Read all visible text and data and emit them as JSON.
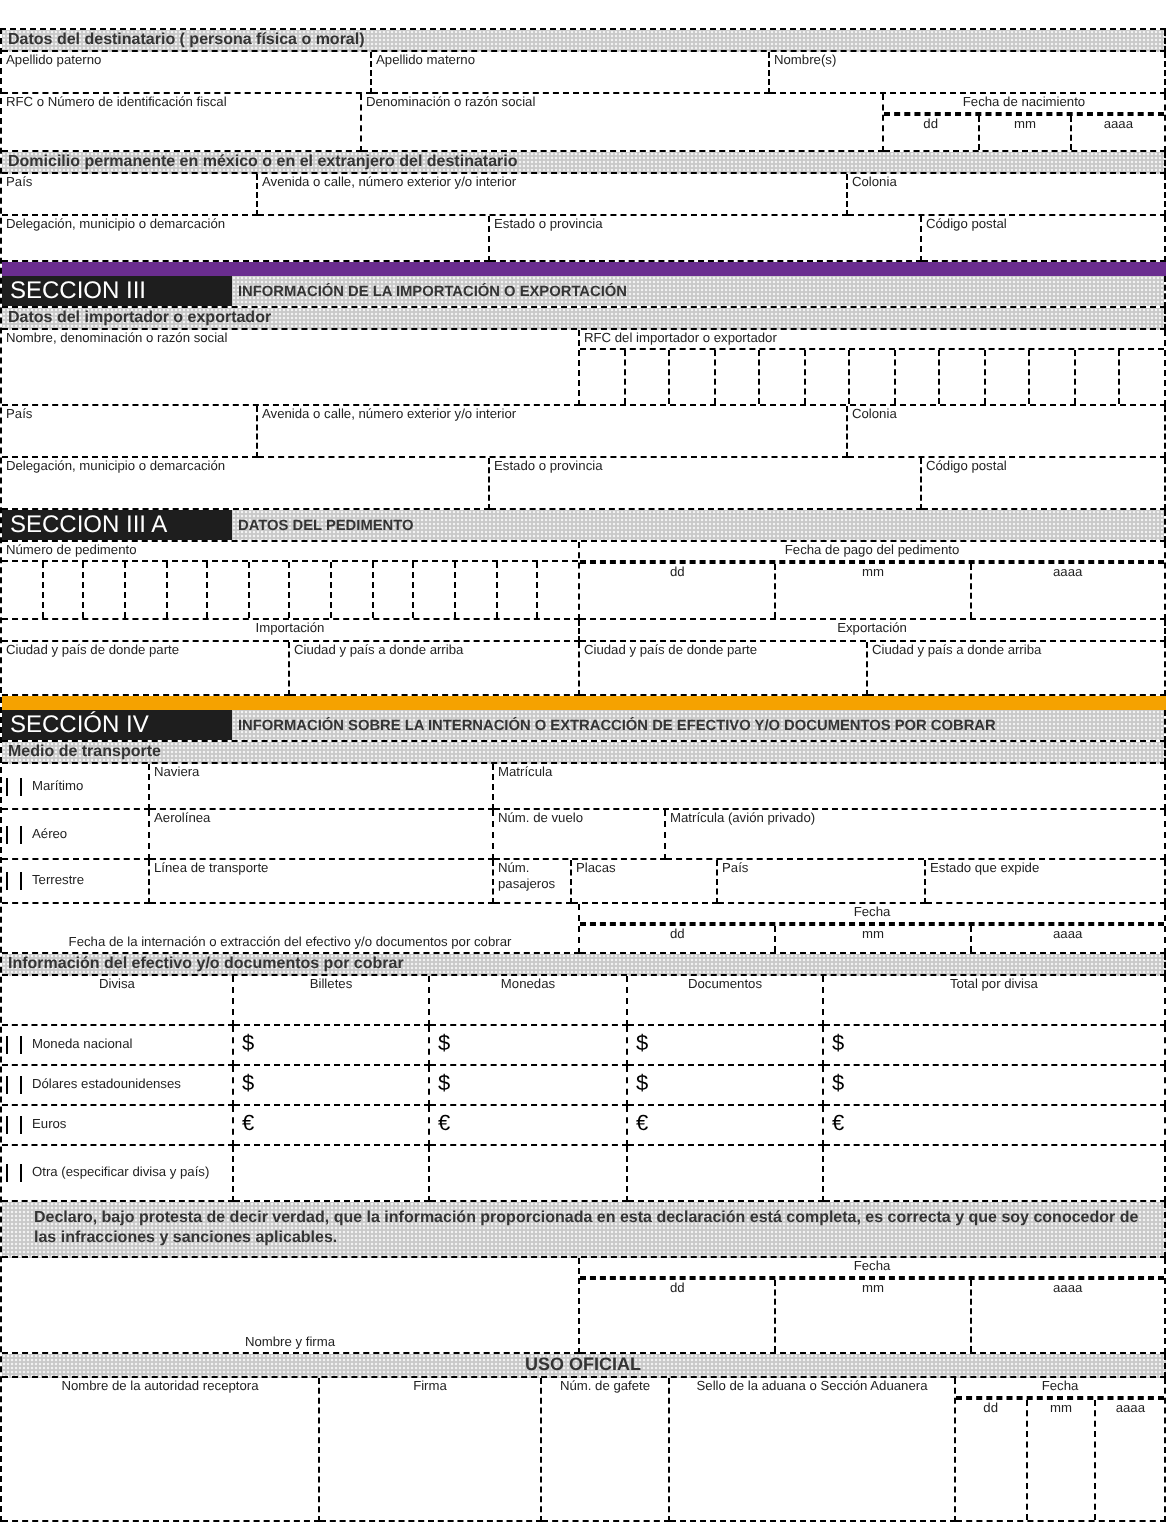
{
  "blocks": [
    {
      "kind": "subheader",
      "title": "Datos del destinatario ( persona física o moral)"
    },
    {
      "kind": "row",
      "cells": [
        {
          "kind": "field",
          "label": "Apellido paterno"
        },
        {
          "kind": "field",
          "label": "Apellido materno"
        },
        {
          "kind": "field",
          "label": "Nombre(s)"
        }
      ]
    },
    {
      "kind": "row",
      "cells": [
        {
          "kind": "field",
          "label": "RFC o Número de identificación fiscal"
        },
        {
          "kind": "field",
          "label": "Denominación o razón social"
        },
        {
          "kind": "date",
          "label": "Fecha de nacimiento",
          "parts": [
            "dd",
            "mm",
            "aaaa"
          ]
        }
      ]
    },
    {
      "kind": "subheader",
      "title": "Domicilio permanente en méxico o en el extranjero del destinatario"
    },
    {
      "kind": "row",
      "cells": [
        {
          "kind": "field",
          "label": "País"
        },
        {
          "kind": "field",
          "label": "Avenida o calle, número exterior y/o interior"
        },
        {
          "kind": "field",
          "label": "Colonia"
        }
      ]
    },
    {
      "kind": "row",
      "cells": [
        {
          "kind": "field",
          "label": "Delegación, municipio o demarcación"
        },
        {
          "kind": "field",
          "label": "Estado o provincia"
        },
        {
          "kind": "field",
          "label": "Código postal"
        }
      ]
    },
    {
      "kind": "section",
      "number": "SECCION III",
      "title": "INFORMACIÓN DE LA IMPORTACIÓN O EXPORTACIÓN",
      "color": "#6a2d8f"
    },
    {
      "kind": "subheader",
      "title": "Datos del importador o exportador"
    },
    {
      "kind": "row",
      "cells": [
        {
          "kind": "field",
          "label": "Nombre, denominación o razón social"
        },
        {
          "kind": "boxes",
          "label": "RFC del importador o exportador"
        }
      ]
    },
    {
      "kind": "row",
      "cells": [
        {
          "kind": "field",
          "label": "País"
        },
        {
          "kind": "field",
          "label": "Avenida o calle, número exterior y/o interior"
        },
        {
          "kind": "field",
          "label": "Colonia"
        }
      ]
    },
    {
      "kind": "row",
      "cells": [
        {
          "kind": "field",
          "label": "Delegación, municipio o demarcación"
        },
        {
          "kind": "field",
          "label": "Estado o provincia"
        },
        {
          "kind": "field",
          "label": "Código postal"
        }
      ]
    },
    {
      "kind": "section",
      "number": "SECCION III A",
      "title": "DATOS DEL PEDIMENTO"
    },
    {
      "kind": "row",
      "cells": [
        {
          "kind": "boxes",
          "label": "Número de pedimento"
        },
        {
          "kind": "date",
          "label": "Fecha de pago del pedimento",
          "parts": [
            "dd",
            "mm",
            "aaaa"
          ]
        }
      ]
    },
    {
      "kind": "row",
      "cells": [
        {
          "kind": "center",
          "label": "Importación"
        },
        {
          "kind": "center",
          "label": "Exportación"
        }
      ]
    },
    {
      "kind": "row",
      "cells": [
        {
          "kind": "field",
          "label": "Ciudad y país de donde parte"
        },
        {
          "kind": "field",
          "label": "Ciudad y país a donde arriba"
        },
        {
          "kind": "field",
          "label": "Ciudad y país de donde parte"
        },
        {
          "kind": "field",
          "label": "Ciudad y país a donde arriba"
        }
      ]
    },
    {
      "kind": "section",
      "number": "SECCIÓN IV",
      "title": "INFORMACIÓN SOBRE LA INTERNACIÓN O EXTRACCIÓN DE EFECTIVO Y/O DOCUMENTOS POR COBRAR",
      "color": "#f5a200"
    },
    {
      "kind": "subheader",
      "title": "Medio de transporte"
    },
    {
      "kind": "row",
      "cells": [
        {
          "kind": "check",
          "label": "Marítimo",
          "checked": false
        },
        {
          "kind": "field",
          "label": "Naviera"
        },
        {
          "kind": "field",
          "label": "Matrícula"
        }
      ]
    },
    {
      "kind": "row",
      "cells": [
        {
          "kind": "check",
          "label": "Aéreo",
          "checked": false
        },
        {
          "kind": "field",
          "label": "Aerolínea"
        },
        {
          "kind": "field",
          "label": "Núm. de vuelo"
        },
        {
          "kind": "field",
          "label": "Matrícula (avión privado)"
        }
      ]
    },
    {
      "kind": "row",
      "cells": [
        {
          "kind": "check",
          "label": "Terrestre",
          "checked": false
        },
        {
          "kind": "field",
          "label": "Línea de transporte"
        },
        {
          "kind": "field",
          "label": "Núm. pasajeros"
        },
        {
          "kind": "field",
          "label": "Placas"
        },
        {
          "kind": "field",
          "label": "País"
        },
        {
          "kind": "field",
          "label": "Estado que expide"
        }
      ]
    },
    {
      "kind": "row",
      "cells": [
        {
          "kind": "bottom",
          "label": "Fecha de la internación o extracción del efectivo y/o documentos por cobrar"
        },
        {
          "kind": "date",
          "label": "Fecha",
          "parts": [
            "dd",
            "mm",
            "aaaa"
          ]
        }
      ]
    },
    {
      "kind": "subheader",
      "title": "Información del efectivo y/o documentos por cobrar"
    },
    {
      "kind": "row",
      "cells": [
        {
          "kind": "center",
          "label": "Divisa"
        },
        {
          "kind": "center",
          "label": "Billetes"
        },
        {
          "kind": "center",
          "label": "Monedas"
        },
        {
          "kind": "center",
          "label": "Documentos"
        },
        {
          "kind": "center",
          "label": "Total por divisa"
        }
      ]
    },
    {
      "kind": "row",
      "cells": [
        {
          "kind": "check",
          "label": "Moneda nacional",
          "checked": false
        },
        {
          "kind": "money",
          "symbol": "$"
        },
        {
          "kind": "money",
          "symbol": "$"
        },
        {
          "kind": "money",
          "symbol": "$"
        },
        {
          "kind": "money",
          "symbol": "$"
        }
      ]
    },
    {
      "kind": "row",
      "cells": [
        {
          "kind": "check",
          "label": "Dólares estadounidenses",
          "checked": false
        },
        {
          "kind": "money",
          "symbol": "$"
        },
        {
          "kind": "money",
          "symbol": "$"
        },
        {
          "kind": "money",
          "symbol": "$"
        },
        {
          "kind": "money",
          "symbol": "$"
        }
      ]
    },
    {
      "kind": "row",
      "cells": [
        {
          "kind": "check",
          "label": "Euros",
          "checked": false
        },
        {
          "kind": "money",
          "symbol": "€"
        },
        {
          "kind": "money",
          "symbol": "€"
        },
        {
          "kind": "money",
          "symbol": "€"
        },
        {
          "kind": "money",
          "symbol": "€"
        }
      ]
    },
    {
      "kind": "row",
      "cells": [
        {
          "kind": "check",
          "label": "Otra (especificar divisa y país)",
          "checked": false
        },
        {
          "kind": "empty"
        },
        {
          "kind": "empty"
        },
        {
          "kind": "empty"
        },
        {
          "kind": "empty"
        }
      ]
    },
    {
      "kind": "declaration",
      "text": "Declaro, bajo protesta de decir verdad, que la información proporcionada en esta declaración está completa, es correcta  y que soy conocedor de las infracciones y sanciones aplicables."
    },
    {
      "kind": "row",
      "cells": [
        {
          "kind": "bottom",
          "label": "Nombre y firma"
        },
        {
          "kind": "date",
          "label": "Fecha",
          "parts": [
            "dd",
            "mm",
            "aaaa"
          ]
        }
      ]
    },
    {
      "kind": "banner",
      "title": "USO OFICIAL"
    },
    {
      "kind": "row",
      "cells": [
        {
          "kind": "center",
          "label": "Nombre de la autoridad receptora"
        },
        {
          "kind": "center",
          "label": "Firma"
        },
        {
          "kind": "center",
          "label": "Núm. de gafete"
        },
        {
          "kind": "center",
          "label": "Sello de la aduana o Sección Aduanera"
        },
        {
          "kind": "date",
          "label": "Fecha",
          "parts": [
            "dd",
            "mm",
            "aaaa"
          ]
        }
      ]
    }
  ]
}
